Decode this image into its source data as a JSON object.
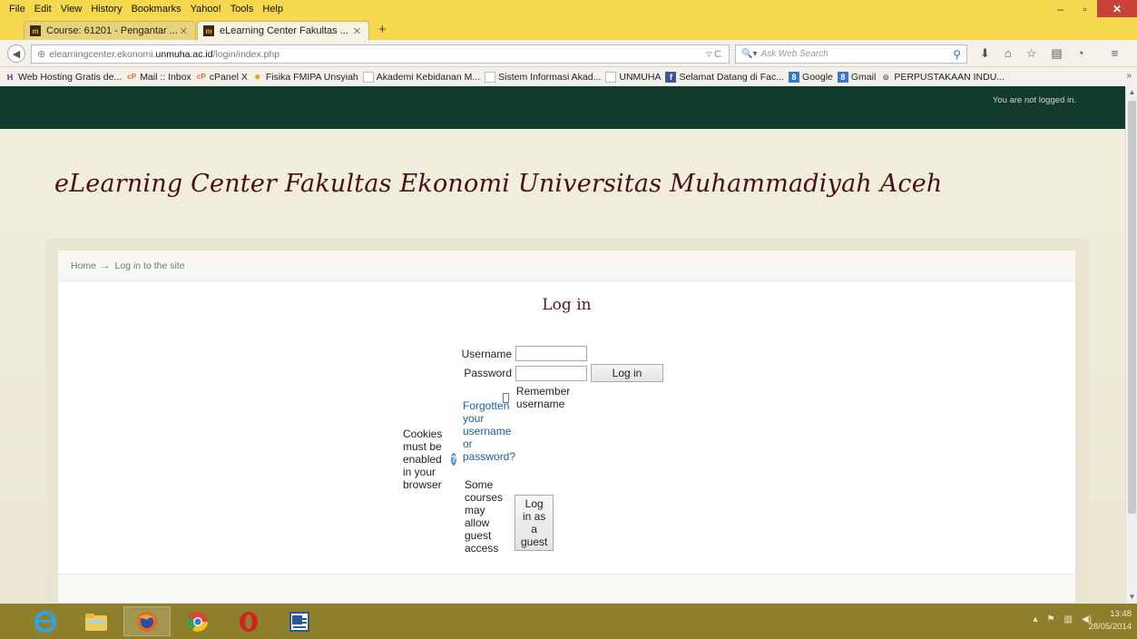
{
  "menu": [
    "File",
    "Edit",
    "View",
    "History",
    "Bookmarks",
    "Yahoo!",
    "Tools",
    "Help"
  ],
  "window_controls": {
    "minimize": "–",
    "restore": "▫",
    "close": "✕"
  },
  "tabs": [
    {
      "label": "Course: 61201 - Pengantar ...",
      "active": false
    },
    {
      "label": "eLearning Center Fakultas ...",
      "active": true
    }
  ],
  "new_tab": "+",
  "url": {
    "prefix": "elearningcenter.ekonomi.",
    "domain": "unmuha.ac.id",
    "path": "/login/index.php"
  },
  "search_placeholder": "Ask Web Search",
  "bookmarks": [
    {
      "label": "Web Hosting Gratis de...",
      "icon": "h"
    },
    {
      "label": "Mail :: Inbox",
      "icon": "cp"
    },
    {
      "label": "cPanel X",
      "icon": "cp"
    },
    {
      "label": "Fisika FMIPA Unsyiah",
      "icon": "fis"
    },
    {
      "label": "Akademi Kebidanan M...",
      "icon": "pg"
    },
    {
      "label": "Sistem Informasi Akad...",
      "icon": "pg"
    },
    {
      "label": "UNMUHA",
      "icon": "fb"
    },
    {
      "label": "Selamat Datang di Fac...",
      "icon": "g8"
    },
    {
      "label": "Google",
      "icon": "g8"
    },
    {
      "label": "Gmail",
      "icon": "lib"
    },
    {
      "label": "PERPUSTAKAAN INDU...",
      "icon": "none"
    }
  ],
  "page": {
    "login_status": "You are not logged in.",
    "site_title": "eLearning Center Fakultas Ekonomi Universitas Muhammadiyah Aceh",
    "breadcrumb": {
      "home": "Home",
      "separator": "→",
      "current": "Log in to the site"
    },
    "login_heading": "Log in",
    "username_label": "Username",
    "password_label": "Password",
    "login_button": "Log in",
    "remember_label": "Remember username",
    "forgot_link": "Forgotten your username or password?",
    "cookies_text": "Cookies must be enabled in your browser",
    "guest_text": "Some courses may allow guest access",
    "guest_button": "Log in as a guest"
  },
  "clock": {
    "time": "13:48",
    "date": "28/05/2014"
  },
  "colors": {
    "menu_bg": "#f5d84e",
    "topbar": "#123a2e",
    "title": "#4a0f14",
    "taskbar": "#8d7f2c"
  }
}
